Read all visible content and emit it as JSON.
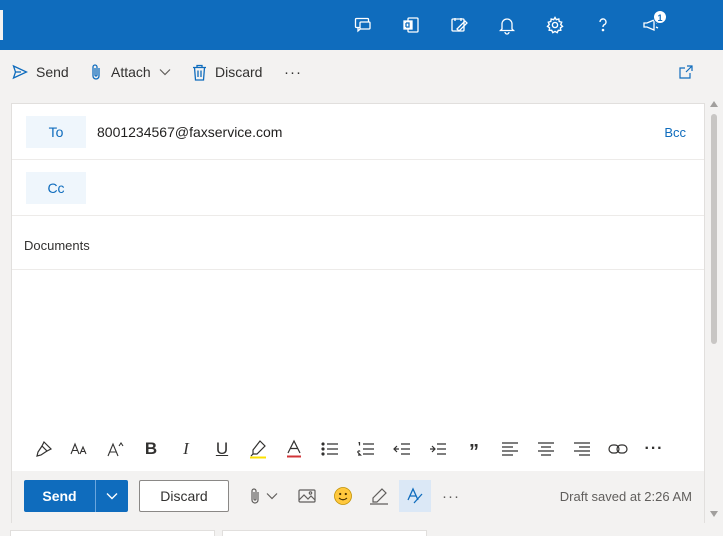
{
  "topbar": {
    "icons": [
      "teams-chat-icon",
      "office-icon",
      "todo-icon",
      "bell-icon",
      "gear-icon",
      "help-icon",
      "megaphone-icon"
    ],
    "notification_count": "1"
  },
  "commands": {
    "send_label": "Send",
    "attach_label": "Attach",
    "discard_label": "Discard",
    "more_label": "···"
  },
  "compose": {
    "to_label": "To",
    "to_value": "8001234567@faxservice.com",
    "bcc_label": "Bcc",
    "cc_label": "Cc",
    "subject": "Documents",
    "body": ""
  },
  "format_toolbar": {
    "bold": "B",
    "italic": "I",
    "underline": "U",
    "quote": "”",
    "more": "···"
  },
  "actions": {
    "send_label": "Send",
    "discard_label": "Discard",
    "more_label": "···",
    "draft_status": "Draft saved at 2:26 AM"
  },
  "colors": {
    "brand": "#0f6cbd",
    "background": "#f3f2f1",
    "highlight": "#fce100",
    "font_color": "#d13438"
  }
}
